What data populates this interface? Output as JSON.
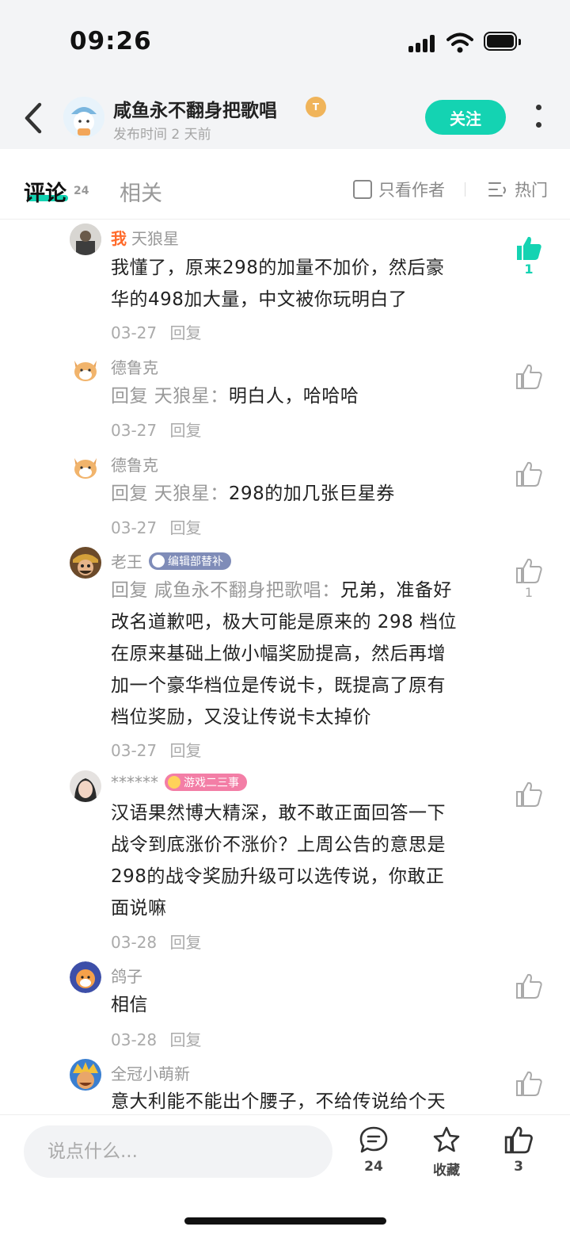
{
  "status": {
    "time": "09:26"
  },
  "header": {
    "author_name": "咸鱼永不翻身把歌唱",
    "author_badge": "T",
    "post_time": "发布时间 2 天前",
    "follow_label": "关注"
  },
  "tabs": {
    "comments_label": "评论",
    "comments_count": "24",
    "related_label": "相关",
    "only_author_label": "只看作者",
    "sort_label": "热门"
  },
  "comments": [
    {
      "me_label": "我",
      "name": "天狼星",
      "lines": [
        "我懂了，原来298的加量不加价，然后豪",
        "华的498加大量，中文被你玩明白了"
      ],
      "date": "03-27",
      "reply_label": "回复",
      "likes": "1"
    },
    {
      "name": "德鲁克",
      "reply_prefix": "回复 天狼星：",
      "lines": [
        "明白人，哈哈哈"
      ],
      "date": "03-27",
      "reply_label": "回复"
    },
    {
      "name": "德鲁克",
      "reply_prefix": "回复 天狼星：",
      "lines": [
        "298的加几张巨星券"
      ],
      "date": "03-27",
      "reply_label": "回复"
    },
    {
      "name": "老王",
      "tag": "编辑部替补",
      "reply_prefix": "回复 咸鱼永不翻身把歌唱：",
      "first_line_rest": "兄弟，准备好",
      "lines": [
        "改名道歉吧，极大可能是原来的 298 档位",
        "在原来基础上做小幅奖励提高，然后再增",
        "加一个豪华档位是传说卡，既提高了原有",
        "档位奖励，又没让传说卡太掉价"
      ],
      "date": "03-27",
      "reply_label": "回复",
      "likes": "1"
    },
    {
      "name": "******",
      "tag": "游戏二三事",
      "lines": [
        "汉语果然博大精深，敢不敢正面回答一下",
        "战令到底涨价不涨价？上周公告的意思是",
        "298的战令奖励升级可以选传说，你敢正",
        "面说嘛"
      ],
      "date": "03-28",
      "reply_label": "回复"
    },
    {
      "name": "鸽子",
      "lines": [
        "相信"
      ],
      "date": "03-28",
      "reply_label": "回复"
    },
    {
      "name": "全冠小萌新",
      "lines": [
        "意大利能不能出个腰子，不给传说给个天"
      ]
    }
  ],
  "bottom": {
    "input_placeholder": "说点什么...",
    "comment_count": "24",
    "favorite_label": "收藏",
    "like_count": "3"
  },
  "colors": {
    "accent": "#14d3b2",
    "me": "#ff6a2a",
    "muted": "#999999"
  }
}
